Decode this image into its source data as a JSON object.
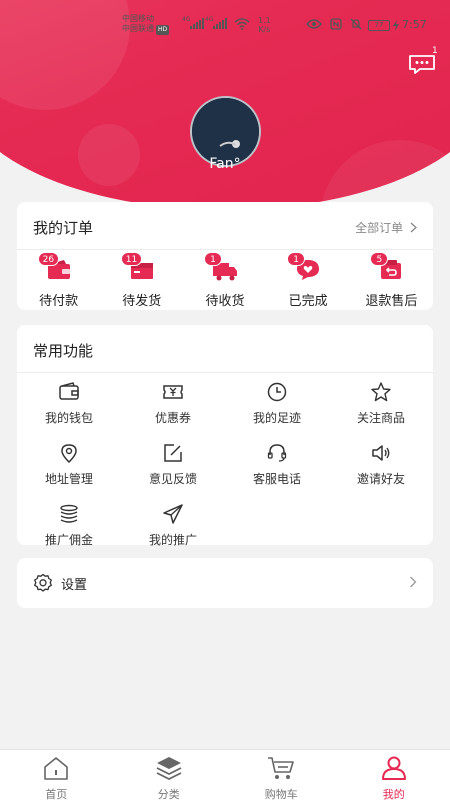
{
  "status_bar": {
    "carrier1": "中国移动",
    "carrier2": "中国联通",
    "hd": "HD",
    "net1": "4G",
    "net2": "4G",
    "speed_value": "1.1",
    "speed_unit": "K/s",
    "battery": "77",
    "time": "7:57"
  },
  "header": {
    "message_badge": "1",
    "nickname": "Fan°"
  },
  "orders": {
    "title": "我的订单",
    "all_label": "全部订单",
    "items": [
      {
        "label": "待付款",
        "count": "26",
        "icon": "wallet-icon"
      },
      {
        "label": "待发货",
        "count": "11",
        "icon": "package-icon"
      },
      {
        "label": "待收货",
        "count": "1",
        "icon": "truck-icon"
      },
      {
        "label": "已完成",
        "count": "1",
        "icon": "heart-bubble-icon"
      },
      {
        "label": "退款售后",
        "count": "5",
        "icon": "refund-icon"
      }
    ]
  },
  "tools": {
    "title": "常用功能",
    "items": [
      {
        "label": "我的钱包",
        "icon": "wallet-icon"
      },
      {
        "label": "优惠券",
        "icon": "coupon-icon"
      },
      {
        "label": "我的足迹",
        "icon": "clock-icon"
      },
      {
        "label": "关注商品",
        "icon": "star-icon"
      },
      {
        "label": "地址管理",
        "icon": "location-icon"
      },
      {
        "label": "意见反馈",
        "icon": "edit-icon"
      },
      {
        "label": "客服电话",
        "icon": "headset-icon"
      },
      {
        "label": "邀请好友",
        "icon": "speaker-icon"
      },
      {
        "label": "推广佣金",
        "icon": "coins-icon"
      },
      {
        "label": "我的推广",
        "icon": "send-icon"
      }
    ]
  },
  "settings": {
    "label": "设置"
  },
  "tabbar": {
    "items": [
      {
        "label": "首页",
        "icon": "home-icon"
      },
      {
        "label": "分类",
        "icon": "layers-icon"
      },
      {
        "label": "购物车",
        "icon": "cart-icon"
      },
      {
        "label": "我的",
        "icon": "user-icon"
      }
    ],
    "active": "我的"
  },
  "colors": {
    "accent": "#e52a53",
    "background": "#f2f2f2"
  }
}
